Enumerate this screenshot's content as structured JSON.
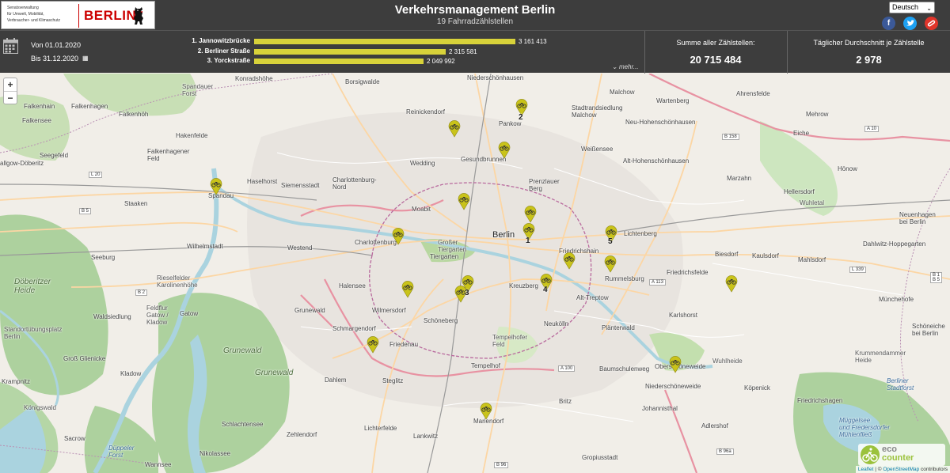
{
  "header": {
    "logo_lines": [
      "Senatsverwaltung",
      "für Umwelt, Mobilität,",
      "Verbraucher- und Klimaschutz"
    ],
    "logo_word": "BERLIN",
    "title": "Verkehrsmanagement Berlin",
    "subtitle": "19 Fahrradzählstellen",
    "language": "Deutsch",
    "social": {
      "facebook": "f",
      "twitter": "t",
      "other": "✉"
    }
  },
  "stats": {
    "date_from": "Von 01.01.2020",
    "date_to": "Bis 31.12.2020",
    "ranking": [
      {
        "label": "1. Jannowitzbrücke",
        "value_text": "3 161 413",
        "value": 3161413
      },
      {
        "label": "2. Berliner Straße",
        "value_text": "2 315 581",
        "value": 2315581
      },
      {
        "label": "3. Yorckstraße",
        "value_text": "2 049 992",
        "value": 2049992
      }
    ],
    "more": "mehr...",
    "total_label": "Summe aller Zählstellen:",
    "total_value": "20 715 484",
    "avg_label": "Täglicher Durchschnitt je Zählstelle",
    "avg_value": "2 978"
  },
  "map": {
    "zoom_in": "+",
    "zoom_out": "−",
    "attribution": {
      "leaflet": "Leaflet",
      "sep": " | © ",
      "osm": "OpenStreetMap",
      "suffix": " contributors"
    },
    "eco_counter": {
      "eco": "eco",
      "counter": "counter"
    },
    "place_labels": {
      "berlin": "Berlin",
      "falkensee": "Falkensee",
      "falkenhain": "Falkenhain",
      "falkenhagen": "Falkenhagen",
      "falkenhoeh": "Falkenhöh",
      "seegefeld": "Seegefeld",
      "hakenfelde": "Hakenfelde",
      "falkenhagener_feld": "Falkenhagener\nFeld",
      "spandau": "Spandau",
      "staaken": "Staaken",
      "haselhorst": "Haselhorst",
      "siemensstadt": "Siemensstadt",
      "charlottenburg_nord": "Charlottenburg-\nNord",
      "wilhelmstadt": "Wilhelmstadt",
      "westend": "Westend",
      "charlottenburg": "Charlottenburg",
      "moabit": "Moabit",
      "tiergarten": "Tiergarten",
      "halensee": "Halensee",
      "wilmersdorf": "Wilmersdorf",
      "schmargendorf": "Schmargendorf",
      "friedenau": "Friedenau",
      "schoeneberg": "Schöneberg",
      "grunewald": "Grunewald",
      "dahlem": "Dahlem",
      "steglitz": "Steglitz",
      "lichterfelde": "Lichterfelde",
      "zehlendorf": "Zehlendorf",
      "schlachtensee": "Schlachtensee",
      "nikolassee": "Nikolassee",
      "wannsee": "Wannsee",
      "lankwitz": "Lankwitz",
      "mariendorf": "Mariendorf",
      "tempelhof": "Tempelhof",
      "kreuzberg": "Kreuzberg",
      "neukoelln": "Neukölln",
      "britz": "Britz",
      "gropiusstadt": "Gropiusstadt",
      "johannisthal": "Johannisthal",
      "adlershof": "Adlershof",
      "baumschulenweg": "Baumschulenweg",
      "treptow": "Alt-Treptow",
      "plaenterwald": "Plänterwald",
      "oberschoeneweide": "Oberschöneweide",
      "niederschoeneweide": "Niederschöneweide",
      "koepenick": "Köpenick",
      "karlshorst": "Karlshorst",
      "friedrichsfelde": "Friedrichsfelde",
      "rummelsburg": "Rummelsburg",
      "lichtenberg": "Lichtenberg",
      "friedrichshain": "Friedrichshain",
      "prenzlauer_berg": "Prenzlauer\nBerg",
      "weissensee": "Weißensee",
      "gesundbrunnen": "Gesundbrunnen",
      "wedding": "Wedding",
      "reinickendorf": "Reinickendorf",
      "pankow": "Pankow",
      "niederschoenhausen": "Niederschönhausen",
      "konradshoehe": "Konradshöhe",
      "borsigwalde": "Borsigwalde",
      "malchow": "Malchow",
      "stadtrandsiedlung": "Stadtrandsiedlung\nMalchow",
      "wartenberg": "Wartenberg",
      "neu_hohenschoenhausen": "Neu-Hohenschönhausen",
      "alt_hohenschoenhausen": "Alt-Hohenschönhausen",
      "ahrensfelde": "Ahrensfelde",
      "marzahn": "Marzahn",
      "hellersdorf": "Hellersdorf",
      "biesdorf": "Biesdorf",
      "kaulsdorf": "Kaulsdorf",
      "mahlsdorf": "Mahlsdorf",
      "neuenhagen": "Neuenhagen\nbei Berlin",
      "schoeneiche": "Schöneiche\nbei Berlin",
      "hoenow": "Hönow",
      "mehrow": "Mehrow",
      "eiche": "Eiche",
      "dahlwitz": "Dahlwitz-Hoppegarten",
      "muenchehofe": "Münchehofe",
      "friedrichshagen": "Friedrichshagen",
      "seeburg": "Seeburg",
      "gatow": "Gatow",
      "kladow": "Kladow",
      "gross_glienicke": "Groß Glienicke",
      "krampnitz": "Krampnitz",
      "sacrow": "Sacrow",
      "waldsiedlung": "Waldsiedlung",
      "doeberitzer_heide": "Döberitzer\nHeide",
      "grunewald_forest": "Grunewald",
      "grunewald_forest2": "Grunewald",
      "duppeler_forst": "Düppeler\nForst",
      "mueggelsee": "Müggelsee\nund Fredersdorfer\nMühlenfließ",
      "berliner_stadtforst": "Berliner\nStadtforst",
      "koenigswald": "Königswald",
      "spandauer_forst": "Spandauer\nForst",
      "tempelhofer_feld": "Tempelhofer\nFeld",
      "grosser_tiergarten": "Großer\nTiergarten",
      "standortuebungsplatz": "Standortübungsplatz\nBerlin",
      "rieselfelder": "Rieselfelder\nKarolinenhöhe",
      "feldflur": "Feldflur\nGatow /\nKladow",
      "wuhlheide": "Wuhlheide",
      "wuhletal": "Wuhletal",
      "krummes_fenn": "Krummendammer\nHeide",
      "dallgow": "allgow-Döberitz"
    },
    "road_labels": [
      "L 20",
      "B 5",
      "B 2",
      "B 158",
      "A 10",
      "L 339",
      "B 1\nB 5",
      "B 96",
      "B 96a",
      "A 100",
      "A 113"
    ],
    "marker_ranks": [
      "1",
      "2",
      "3",
      "4",
      "5"
    ]
  }
}
